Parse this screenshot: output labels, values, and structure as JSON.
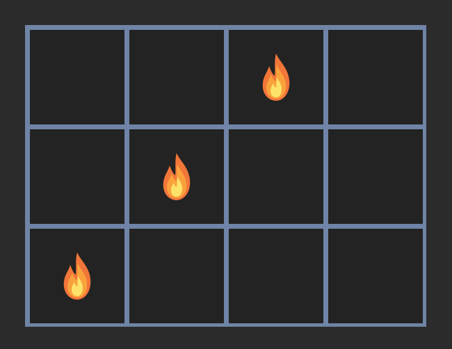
{
  "board": {
    "rows": 3,
    "cols": 4,
    "cells": [
      [
        "empty",
        "empty",
        "fire",
        "empty"
      ],
      [
        "empty",
        "fire",
        "empty",
        "empty"
      ],
      [
        "fire",
        "empty",
        "empty",
        "empty"
      ]
    ],
    "icon": "fire-icon",
    "colors": {
      "background": "#2b2b2b",
      "grid_lines": "#6f84a6",
      "cell": "#232323",
      "flame_outer": "#f2763a",
      "flame_mid": "#f9a23c",
      "flame_inner": "#fde26a"
    }
  }
}
